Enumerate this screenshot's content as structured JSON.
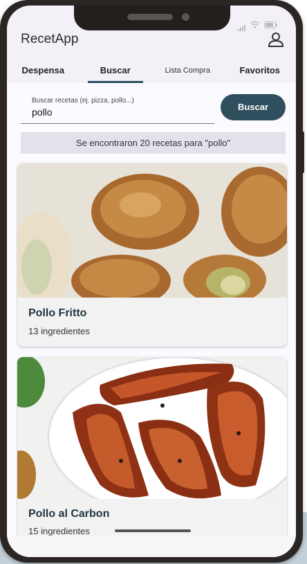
{
  "app": {
    "title": "RecetApp"
  },
  "tabs": [
    {
      "label": "Despensa",
      "active": false
    },
    {
      "label": "Buscar",
      "active": true
    },
    {
      "label": "Lista Compra",
      "active": false
    },
    {
      "label": "Favoritos",
      "active": false
    }
  ],
  "search": {
    "label": "Buscar recetas (ej. pizza, pollo...)",
    "value": "pollo",
    "button_label": "Buscar"
  },
  "results": {
    "banner": "Se encontraron 20 recetas para \"pollo\""
  },
  "recipes": [
    {
      "title": "Pollo Fritto",
      "ingredients": "13 ingredientes"
    },
    {
      "title": "Pollo al Carbon",
      "ingredients": "15 ingredientes"
    }
  ],
  "colors": {
    "accent": "#2f4f5f",
    "screen_bg": "#f3f0f8",
    "banner_bg": "#e3e1ea"
  },
  "icons": {
    "account": "account-icon",
    "wifi": "wifi-icon",
    "signal": "signal-icon",
    "battery": "battery-icon"
  }
}
